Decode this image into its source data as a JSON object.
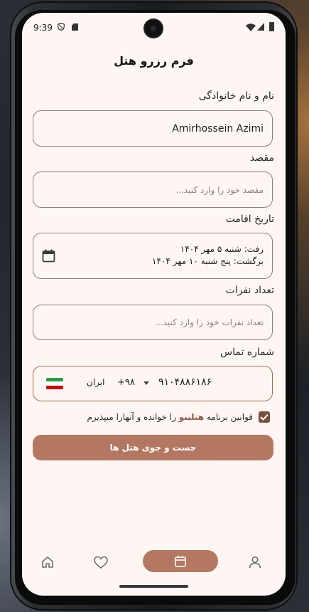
{
  "status_bar": {
    "time": "9:39",
    "icons": [
      "shield-icon",
      "sd-card-icon",
      "wifi-icon",
      "signal-icon",
      "battery-icon"
    ]
  },
  "form": {
    "title": "فرم رزرو هتل",
    "name": {
      "label": "نام و نام خانوادگی",
      "value": "Amirhossein Azimi"
    },
    "destination": {
      "label": "مقصد",
      "placeholder": "مقصد خود را وارد کنید..."
    },
    "stay_date": {
      "label": "تاریخ اقامت",
      "departure": "رفت: شنبه ۵ مهر ۱۴۰۴",
      "return": "برگشت: پنج شنبه ۱۰ مهر ۱۴۰۴",
      "icon": "calendar-icon"
    },
    "guests": {
      "label": "تعداد نفرات",
      "placeholder": "تعداد نفرات خود را وارد کنید..."
    },
    "phone": {
      "label": "شماره تماس",
      "number": "۹۱۰۴۸۸۶۱۸۶",
      "country_code": "+۹۸",
      "country": "ایران",
      "flag_colors": [
        "#239f40",
        "#ffffff",
        "#da0000"
      ]
    },
    "terms": {
      "prefix": "قوانین برنامه",
      "brand": "هتلینو",
      "suffix": "را خوانده و آنهارا میپذیرم",
      "checked": true
    },
    "submit_label": "جست و جوی هتل ها"
  },
  "bottom_nav": {
    "items": [
      {
        "icon": "home-icon",
        "active": false
      },
      {
        "icon": "heart-icon",
        "active": false
      },
      {
        "icon": "calendar-icon",
        "active": true
      },
      {
        "icon": "profile-icon",
        "active": false
      }
    ]
  },
  "colors": {
    "accent": "#b47862",
    "background": "#fef6f3",
    "checkbox": "#7a4f3f"
  }
}
